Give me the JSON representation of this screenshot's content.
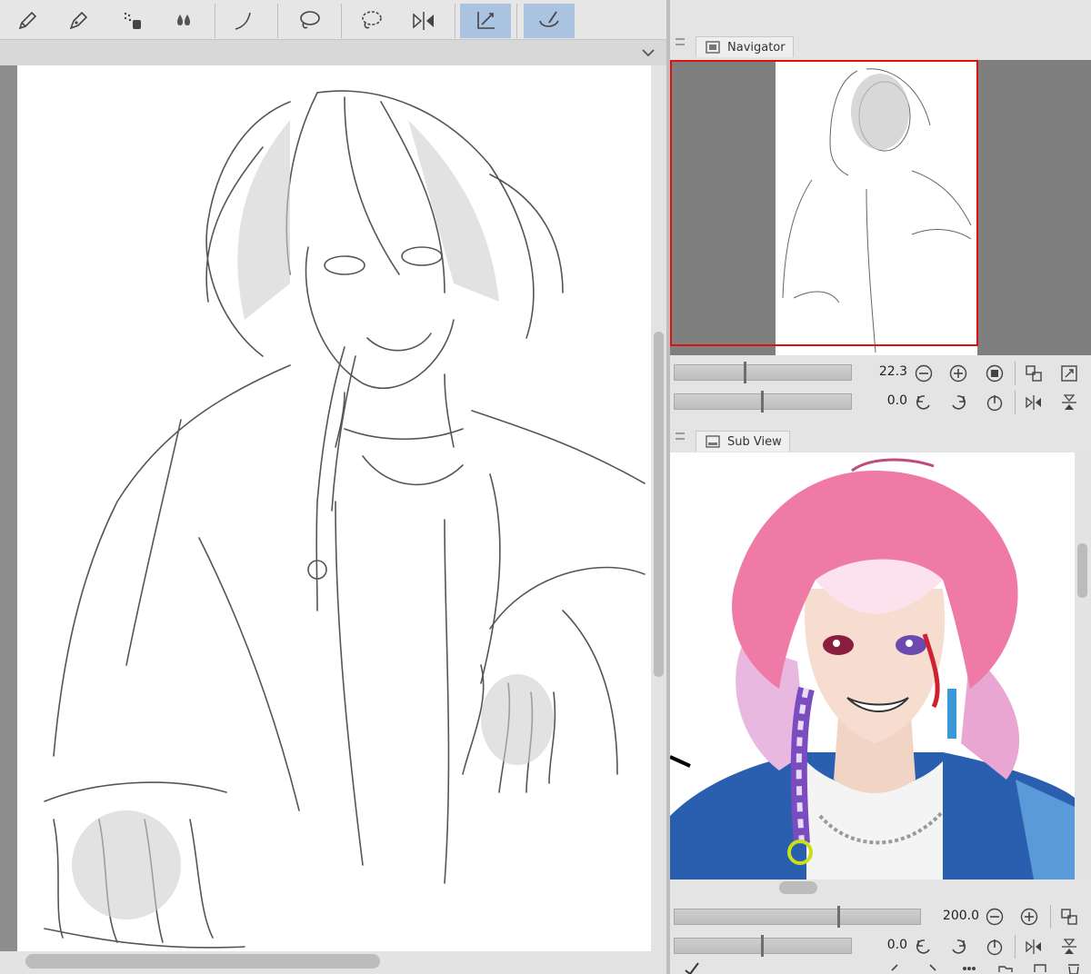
{
  "toolbar": {
    "tools": [
      {
        "name": "pencil-tool",
        "icon": "pencil-icon"
      },
      {
        "name": "pen-tool",
        "icon": "pen-icon"
      },
      {
        "name": "airbrush-tool",
        "icon": "airbrush-icon"
      },
      {
        "name": "blend-tool",
        "icon": "water-drops-icon"
      },
      {
        "name": "curve-tool",
        "icon": "curve-icon"
      },
      {
        "name": "lasso-tool",
        "icon": "lasso-icon"
      },
      {
        "name": "lasso-fill-tool",
        "icon": "lasso-fill-icon"
      },
      {
        "name": "flip-tool",
        "icon": "flip-horizontal-icon"
      },
      {
        "name": "vector-eraser-tool",
        "icon": "vector-eraser-icon",
        "active": true
      },
      {
        "name": "correct-line-tool",
        "icon": "correct-line-icon",
        "active": true
      }
    ],
    "expand_icon": "chevron-down-icon"
  },
  "canvas": {
    "description_icon": "sketch-artwork",
    "paper_color": "#ffffff",
    "horizontal_scroll_position": 0.0,
    "vertical_scroll_position": 0.3
  },
  "navigator": {
    "tab_label": "Navigator",
    "zoom_value": "22.3",
    "rotation_value": "0.0",
    "frame_color": "#e01010"
  },
  "subview": {
    "tab_label": "Sub View",
    "zoom_value": "200.0",
    "rotation_value": "0.0"
  },
  "colors": {
    "active_tool_bg": "#a9c3e0",
    "panel_bg": "#e4e4e4",
    "hair_pink": "#f07aa6",
    "jacket_blue": "#2a5fb0"
  }
}
